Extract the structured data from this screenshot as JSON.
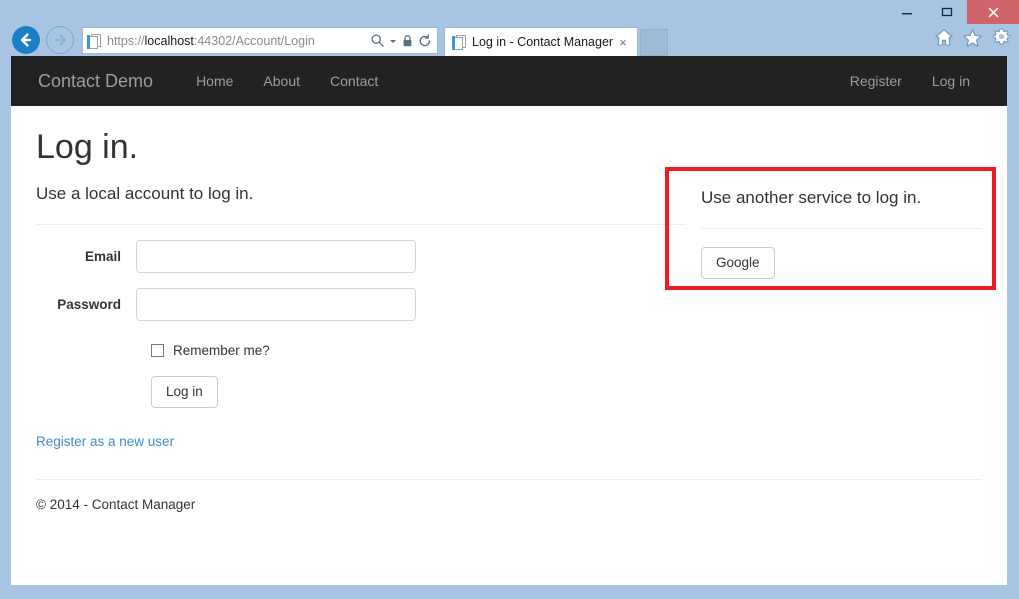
{
  "browser": {
    "window_controls": {
      "minimize": "minimize-label",
      "maximize": "maximize-label",
      "close": "close-label"
    },
    "back_label": "Back",
    "forward_label": "Forward",
    "address": {
      "protocol": "https://",
      "host": "localhost",
      "path": ":44302/Account/Login",
      "full_url": "https://localhost:44302/Account/Login",
      "icons": [
        "search-icon",
        "caret-down-icon",
        "lock-icon",
        "refresh-icon"
      ]
    },
    "tab": {
      "title": "Log in - Contact Manager",
      "close_label": "×"
    },
    "toolbar_icons": [
      "home-icon",
      "favorites-star-icon",
      "settings-gear-icon"
    ]
  },
  "site": {
    "brand": "Contact Demo",
    "nav_left": [
      {
        "label": "Home"
      },
      {
        "label": "About"
      },
      {
        "label": "Contact"
      }
    ],
    "nav_right": [
      {
        "label": "Register"
      },
      {
        "label": "Log in"
      }
    ]
  },
  "page": {
    "heading": "Log in.",
    "local": {
      "subheading": "Use a local account to log in.",
      "email_label": "Email",
      "email_value": "",
      "password_label": "Password",
      "password_value": "",
      "remember_label": "Remember me?",
      "remember_checked": false,
      "submit_label": "Log in",
      "register_link": "Register as a new user"
    },
    "external": {
      "subheading": "Use another service to log in.",
      "providers": [
        {
          "label": "Google"
        }
      ]
    },
    "footer": "© 2014 - Contact Manager"
  },
  "annotation": {
    "color": "#ed1c24",
    "target": "external-login-panel"
  }
}
